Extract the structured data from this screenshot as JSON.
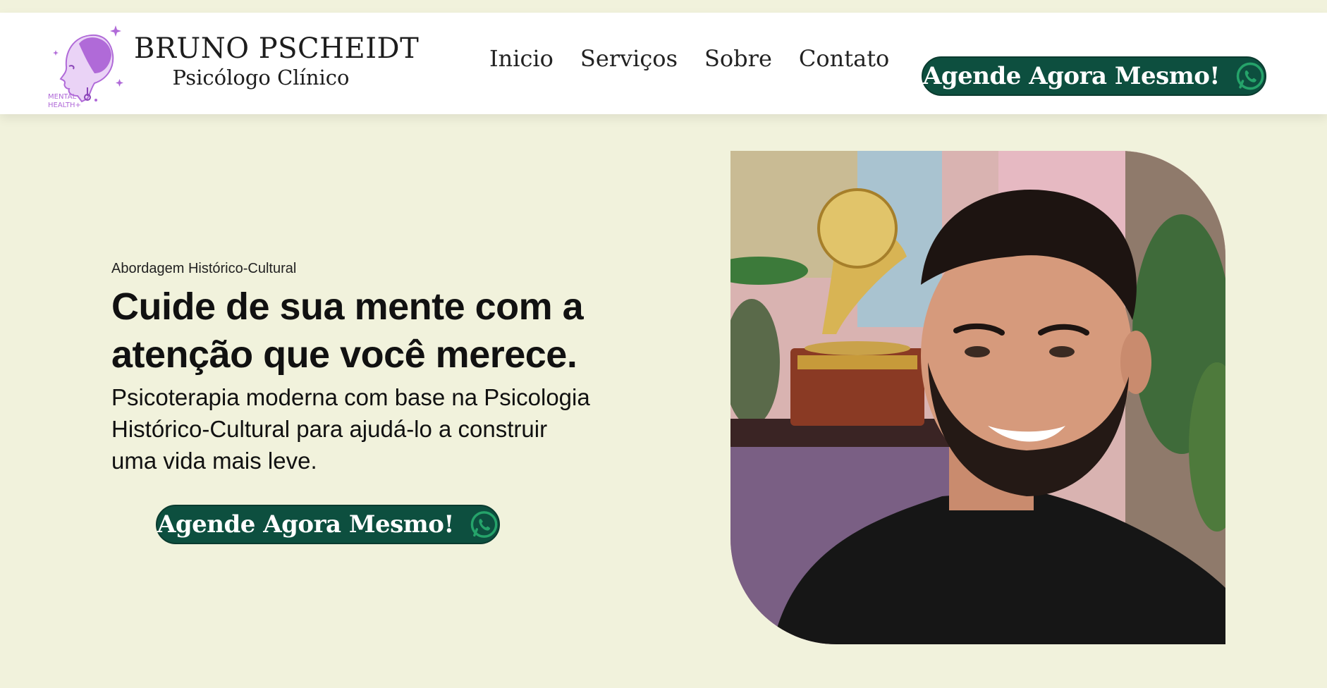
{
  "header": {
    "brand_name": "BRUNO PSCHEIDT",
    "brand_subtitle": "Psicólogo Clínico",
    "logo_text_line1": "MENTAL",
    "logo_text_line2": "HEALTH+",
    "nav": [
      {
        "label": "Inicio"
      },
      {
        "label": "Serviços"
      },
      {
        "label": "Sobre"
      },
      {
        "label": "Contato"
      }
    ],
    "cta_label": "Agende Agora Mesmo!",
    "cta_icon": "whatsapp-icon"
  },
  "hero": {
    "eyebrow": "Abordagem Histórico-Cultural",
    "headline": "Cuide de sua mente com a atenção que você merece.",
    "subtext": "Psicoterapia moderna com base na Psicologia Histórico-Cultural para ajudá-lo a construir uma vida mais leve.",
    "cta_label": "Agende Agora Mesmo!",
    "cta_icon": "whatsapp-icon",
    "photo_description": "portrait-photo"
  },
  "colors": {
    "background": "#f1f2dc",
    "accent_green": "#0d4f3f",
    "logo_purple": "#b06ad8",
    "whatsapp_green": "#25a36a"
  }
}
